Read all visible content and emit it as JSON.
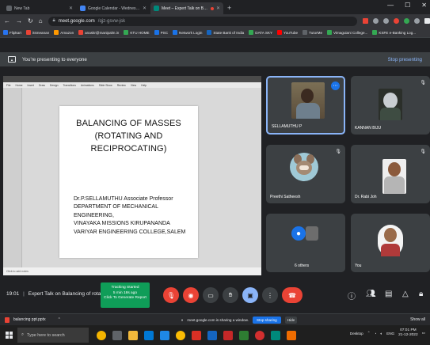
{
  "browser": {
    "tabs": [
      {
        "label": "New Tab",
        "active": false,
        "favicon_color": "#5f6368"
      },
      {
        "label": "Google Calendar - Wednesday, 2",
        "active": false,
        "favicon_color": "#4285f4"
      },
      {
        "label": "Meet – Expert Talk on Balan",
        "active": true,
        "favicon_color": "#00897b"
      }
    ],
    "new_tab_symbol": "+",
    "url_host": "meet.google.com",
    "url_path": "/qjz-gsvw-jsk",
    "bookmarks": [
      {
        "label": "Flipkart",
        "color": "#2874f0"
      },
      {
        "label": "itsmeanan",
        "color": "#ea4335"
      },
      {
        "label": "Amazon",
        "color": "#ff9900"
      },
      {
        "label": "anaskr@manipalm.in",
        "color": "#ea4335"
      },
      {
        "label": "KTU HOME",
        "color": "#34a853"
      },
      {
        "label": "PSC",
        "color": "#1a73e8"
      },
      {
        "label": "Network Login",
        "color": "#1a73e8"
      },
      {
        "label": "State Bank of India",
        "color": "#1565c0"
      },
      {
        "label": "DATA SKY",
        "color": "#34a853"
      },
      {
        "label": "YouTube",
        "color": "#ff0000"
      },
      {
        "label": "TutorMe",
        "color": "#5f6368"
      },
      {
        "label": "Vimaguiani College...",
        "color": "#34a853"
      },
      {
        "label": "KSFE e-Banking Log...",
        "color": "#34a853"
      }
    ]
  },
  "meet": {
    "banner_text": "You're presenting to everyone",
    "stop_presenting": "Stop presenting",
    "meeting_time": "19:01",
    "meeting_title": "Expert Talk on Balancing of rota...",
    "tracking": {
      "line1": "Tracking Started",
      "line2": "5 min 18s ago",
      "line3": "Click To Generate Report"
    },
    "participants": [
      {
        "name": "SELLAMUTHU P",
        "active": true
      },
      {
        "name": "KANNAN BIJU",
        "active": false
      },
      {
        "name": "Preethi Satheesh",
        "active": false
      },
      {
        "name": "Dr. Rabi Joh",
        "active": false
      },
      {
        "name": "6 others",
        "active": false
      },
      {
        "name": "You",
        "active": false
      }
    ],
    "icons": {
      "mic": "mic-icon",
      "camera": "camera-icon",
      "captions": "captions-icon",
      "hand": "raise-hand-icon",
      "present": "present-icon",
      "more": "more-options-icon",
      "end": "end-call-icon",
      "info": "info-icon",
      "people": "people-icon",
      "chat": "chat-icon",
      "activities": "activities-icon",
      "lock": "host-controls-icon"
    }
  },
  "slide": {
    "title_lines": [
      "BALANCING OF MASSES",
      "(ROTATING AND",
      "RECIPROCATING)"
    ],
    "body_lines": [
      "Dr.P.SELLAMUTHU Associate Professor",
      "DEPARTMENT OF MECHANICAL",
      "ENGINEERING,",
      "VINAYAKA MISSIONS KIRUPANANDA",
      "VARIYAR ENGINEERING COLLEGE,SALEM"
    ]
  },
  "ppt": {
    "menu": [
      "File",
      "Home",
      "Insert",
      "Draw",
      "Design",
      "Transitions",
      "Animations",
      "Slide Show",
      "Review",
      "View",
      "Help"
    ],
    "status_left": "Click to add notes"
  },
  "downloads": {
    "file": "balancing ppt.pptx",
    "sharing_msg": "meet.google.com is sharing a window.",
    "stop_sharing": "Stop sharing",
    "hide": "Hide",
    "show_all": "Show all"
  },
  "taskbar": {
    "search_placeholder": "Type here to search",
    "tray_label": "Desktop",
    "lang": "ENG",
    "time": "07:01 PM",
    "date": "21-12-2022"
  }
}
